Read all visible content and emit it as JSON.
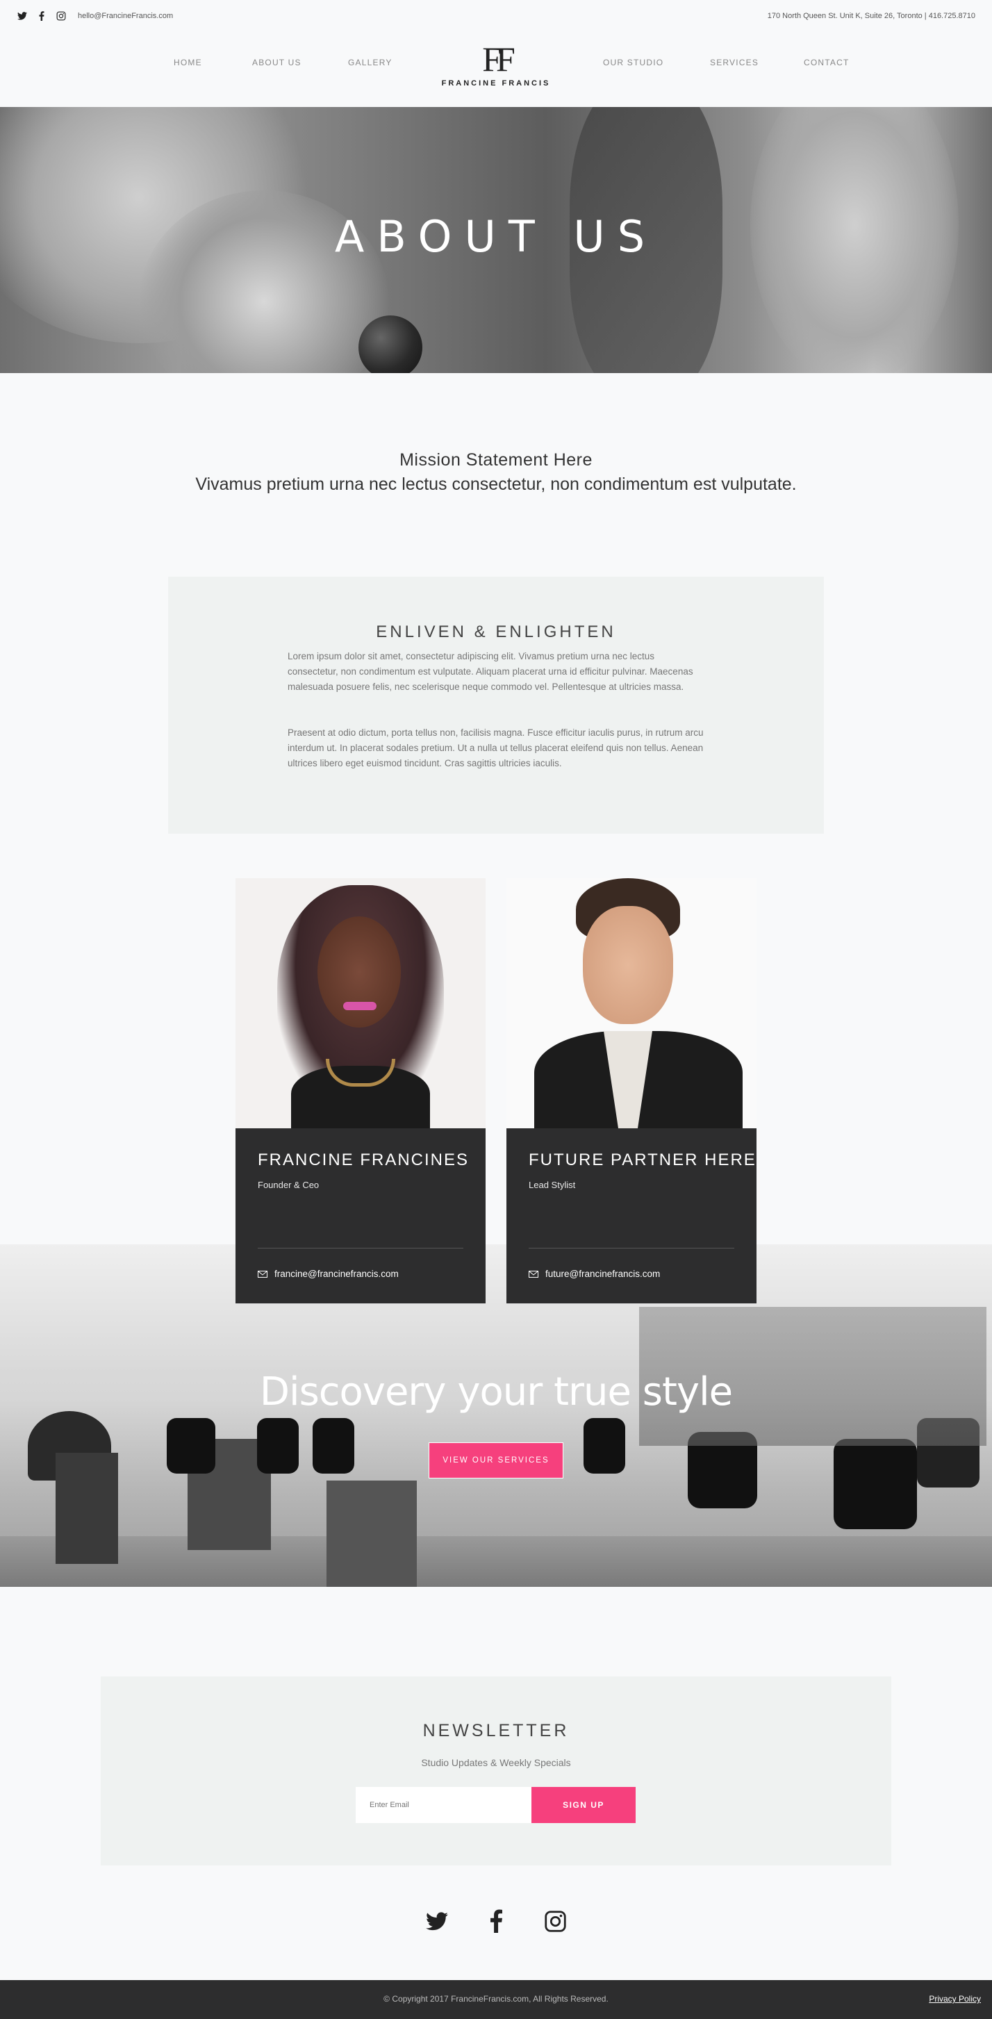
{
  "topbar": {
    "email": "hello@FrancineFrancis.com",
    "address": "170 North Queen St. Unit K, Suite 26, Toronto | 416.725.8710",
    "icons": [
      "twitter-icon",
      "facebook-icon",
      "instagram-icon"
    ]
  },
  "nav": {
    "left": [
      "HOME",
      "ABOUT US",
      "GALLERY"
    ],
    "right": [
      "OUR STUDIO",
      "SERVICES",
      "CONTACT"
    ],
    "logo_mark": "FF",
    "logo_word": "FRANCINE FRANCIS"
  },
  "hero": {
    "title": "ABOUT US"
  },
  "mission": {
    "line1": "Mission Statement Here",
    "line2": "Vivamus pretium urna nec lectus consectetur, non condimentum est vulputate."
  },
  "enliven": {
    "title": "ENLIVEN & ENLIGHTEN",
    "p1": "Lorem ipsum dolor sit amet, consectetur adipiscing elit. Vivamus pretium urna nec lectus consectetur, non condimentum est vulputate. Aliquam placerat urna id efficitur pulvinar. Maecenas malesuada posuere felis, nec scelerisque neque commodo vel. Pellentesque at ultricies massa.",
    "p2": "Praesent at odio dictum, porta tellus non, facilisis magna. Fusce efficitur iaculis purus, in rutrum arcu interdum ut. In placerat sodales pretium. Ut a nulla ut tellus placerat eleifend quis non tellus. Aenean ultrices libero eget euismod tincidunt. Cras sagittis ultricies iaculis."
  },
  "team": [
    {
      "name": "FRANCINE FRANCINES",
      "role": "Founder & Ceo",
      "email": "francine@francinefrancis.com"
    },
    {
      "name": "FUTURE PARTNER HERE",
      "role": "Lead Stylist",
      "email": "future@francinefrancis.com"
    }
  ],
  "salon": {
    "headline": "Discovery your true style",
    "button": "VIEW OUR SERVICES"
  },
  "newsletter": {
    "title": "NEWSLETTER",
    "subtitle": "Studio Updates & Weekly Specials",
    "placeholder": "Enter Email",
    "button": "SIGN UP"
  },
  "footer": {
    "copyright": "© Copyright 2017 FrancineFrancis.com, All Rights Reserved.",
    "privacy": "Privacy Policy"
  },
  "colors": {
    "accent": "#f6407d",
    "dark": "#2d2d2e",
    "panel": "#eff2f1",
    "page": "#f8f9fa"
  }
}
